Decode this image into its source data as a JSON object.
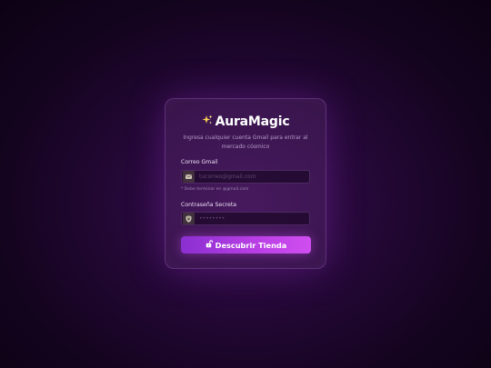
{
  "brand": {
    "title": "AuraMagic",
    "icon": "sparkles-icon"
  },
  "subtitle": "Ingresa cualquier cuenta Gmail para entrar al mercado cósmico",
  "form": {
    "email": {
      "label": "Correo Gmail",
      "placeholder": "tucorreo@gmail.com",
      "value": "",
      "icon": "envelope-icon",
      "hint": "* Debe terminar en @gmail.com"
    },
    "password": {
      "label": "Contraseña Secreta",
      "placeholder": "••••••••",
      "value": "",
      "icon": "shield-icon"
    },
    "submit": {
      "label": "Descubrir Tienda",
      "icon": "unlock-icon"
    }
  },
  "colors": {
    "accent_start": "#8a2fd0",
    "accent_end": "#d04ef0",
    "sparkle": "#ffd35a"
  }
}
